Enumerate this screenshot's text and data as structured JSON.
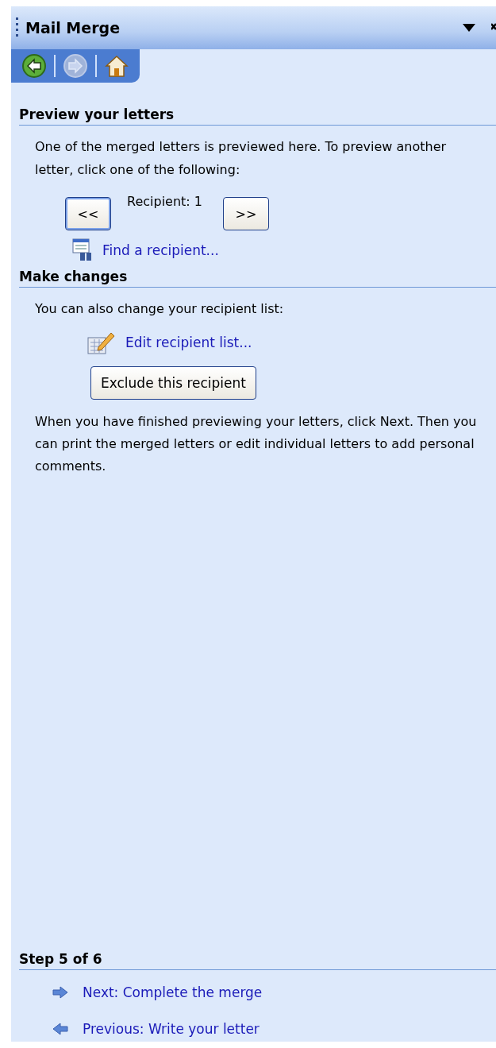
{
  "panel": {
    "title": "Mail Merge"
  },
  "nav": [
    {
      "kind": "back",
      "disabled": false
    },
    {
      "kind": "forward",
      "disabled": true
    },
    {
      "kind": "home",
      "disabled": false
    }
  ],
  "preview": {
    "heading": "Preview your letters",
    "text": "One of the merged letters is previewed here. To preview another letter, click one of the following:",
    "prev_button": "<<",
    "recipient": "Recipient: 1",
    "next_button": ">>",
    "find_link": "Find a recipient..."
  },
  "changes": {
    "heading": "Make changes",
    "text": "You can also change your recipient list:",
    "edit_link": "Edit recipient list...",
    "exclude_button": "Exclude this recipient",
    "note": "When you have finished previewing your letters, click Next. Then you can print the merged letters or edit individual letters to add personal comments."
  },
  "step": {
    "heading": "Step 5 of 6",
    "links": [
      {
        "kind": "next",
        "label": "Next: Complete the merge"
      },
      {
        "kind": "previous",
        "label": "Previous: Write your letter"
      }
    ]
  }
}
